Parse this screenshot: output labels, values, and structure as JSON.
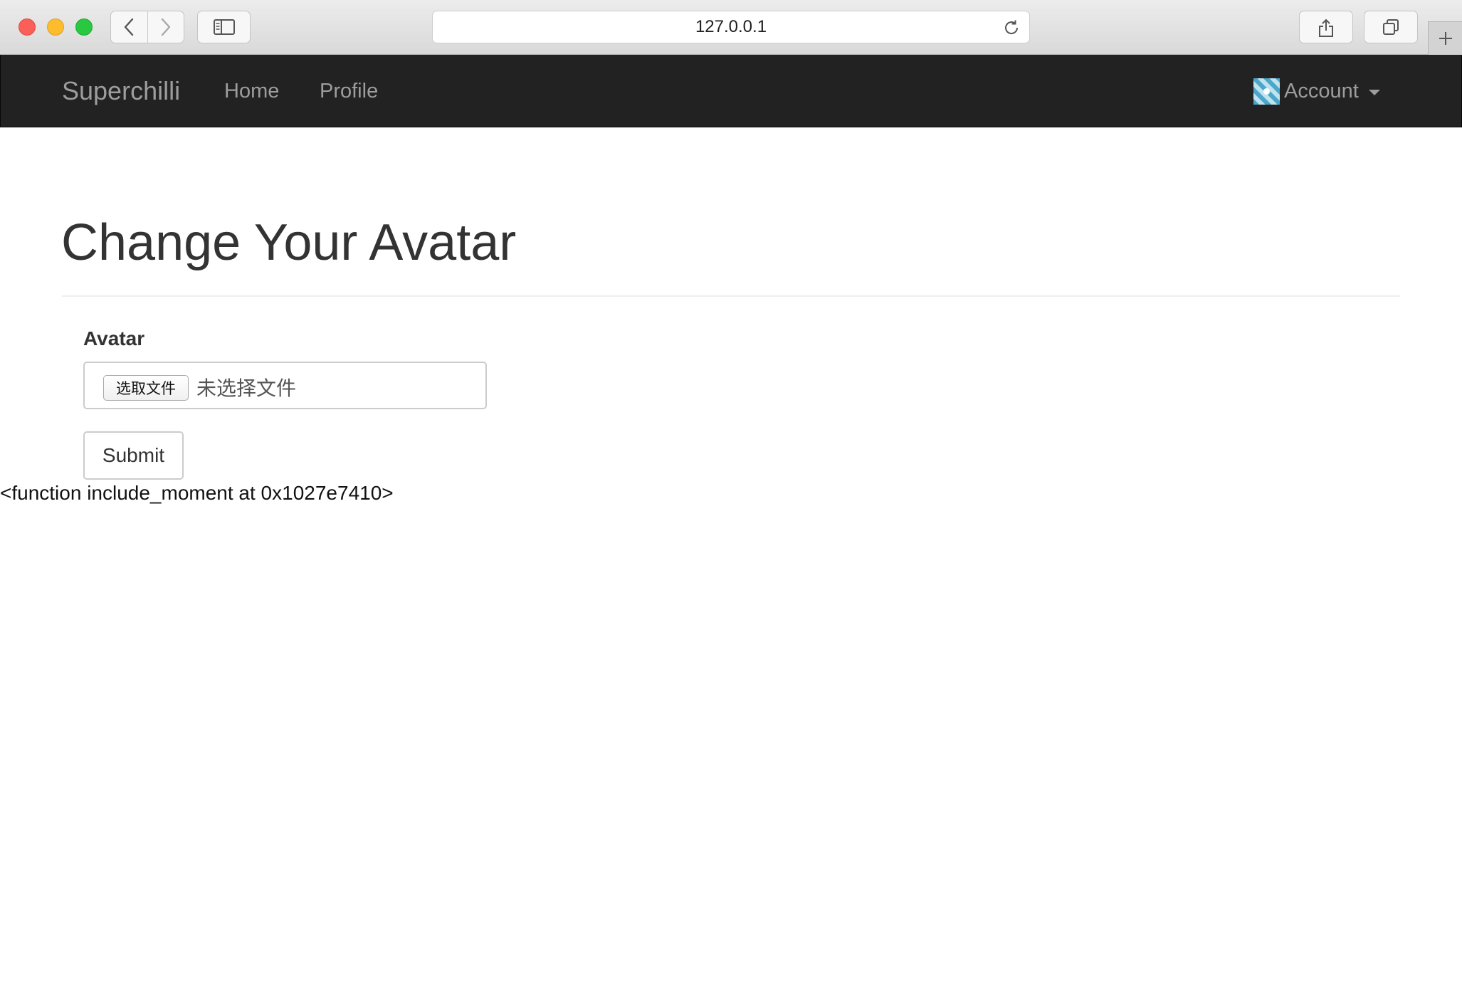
{
  "browser": {
    "address": "127.0.0.1",
    "icons": {
      "close": "close-window-icon",
      "minimize": "minimize-window-icon",
      "zoom": "zoom-window-icon",
      "back": "chevron-left-icon",
      "forward": "chevron-right-icon",
      "sidebar": "sidebar-icon",
      "reload": "reload-icon",
      "share": "share-icon",
      "tabs": "tabs-icon",
      "new_tab": "plus-icon"
    }
  },
  "navbar": {
    "brand": "Superchilli",
    "links": [
      {
        "label": "Home"
      },
      {
        "label": "Profile"
      }
    ],
    "account": {
      "label": "Account",
      "caret_icon": "caret-down-icon"
    }
  },
  "page": {
    "title": "Change Your Avatar",
    "form": {
      "avatar_label": "Avatar",
      "file_button_label": "选取文件",
      "file_status": "未选择文件",
      "submit_label": "Submit"
    },
    "debug_output": "<function include_moment at 0x1027e7410>"
  },
  "colors": {
    "navbar_bg": "#222222",
    "nav_text": "#9d9d9d",
    "title_text": "#333333"
  }
}
